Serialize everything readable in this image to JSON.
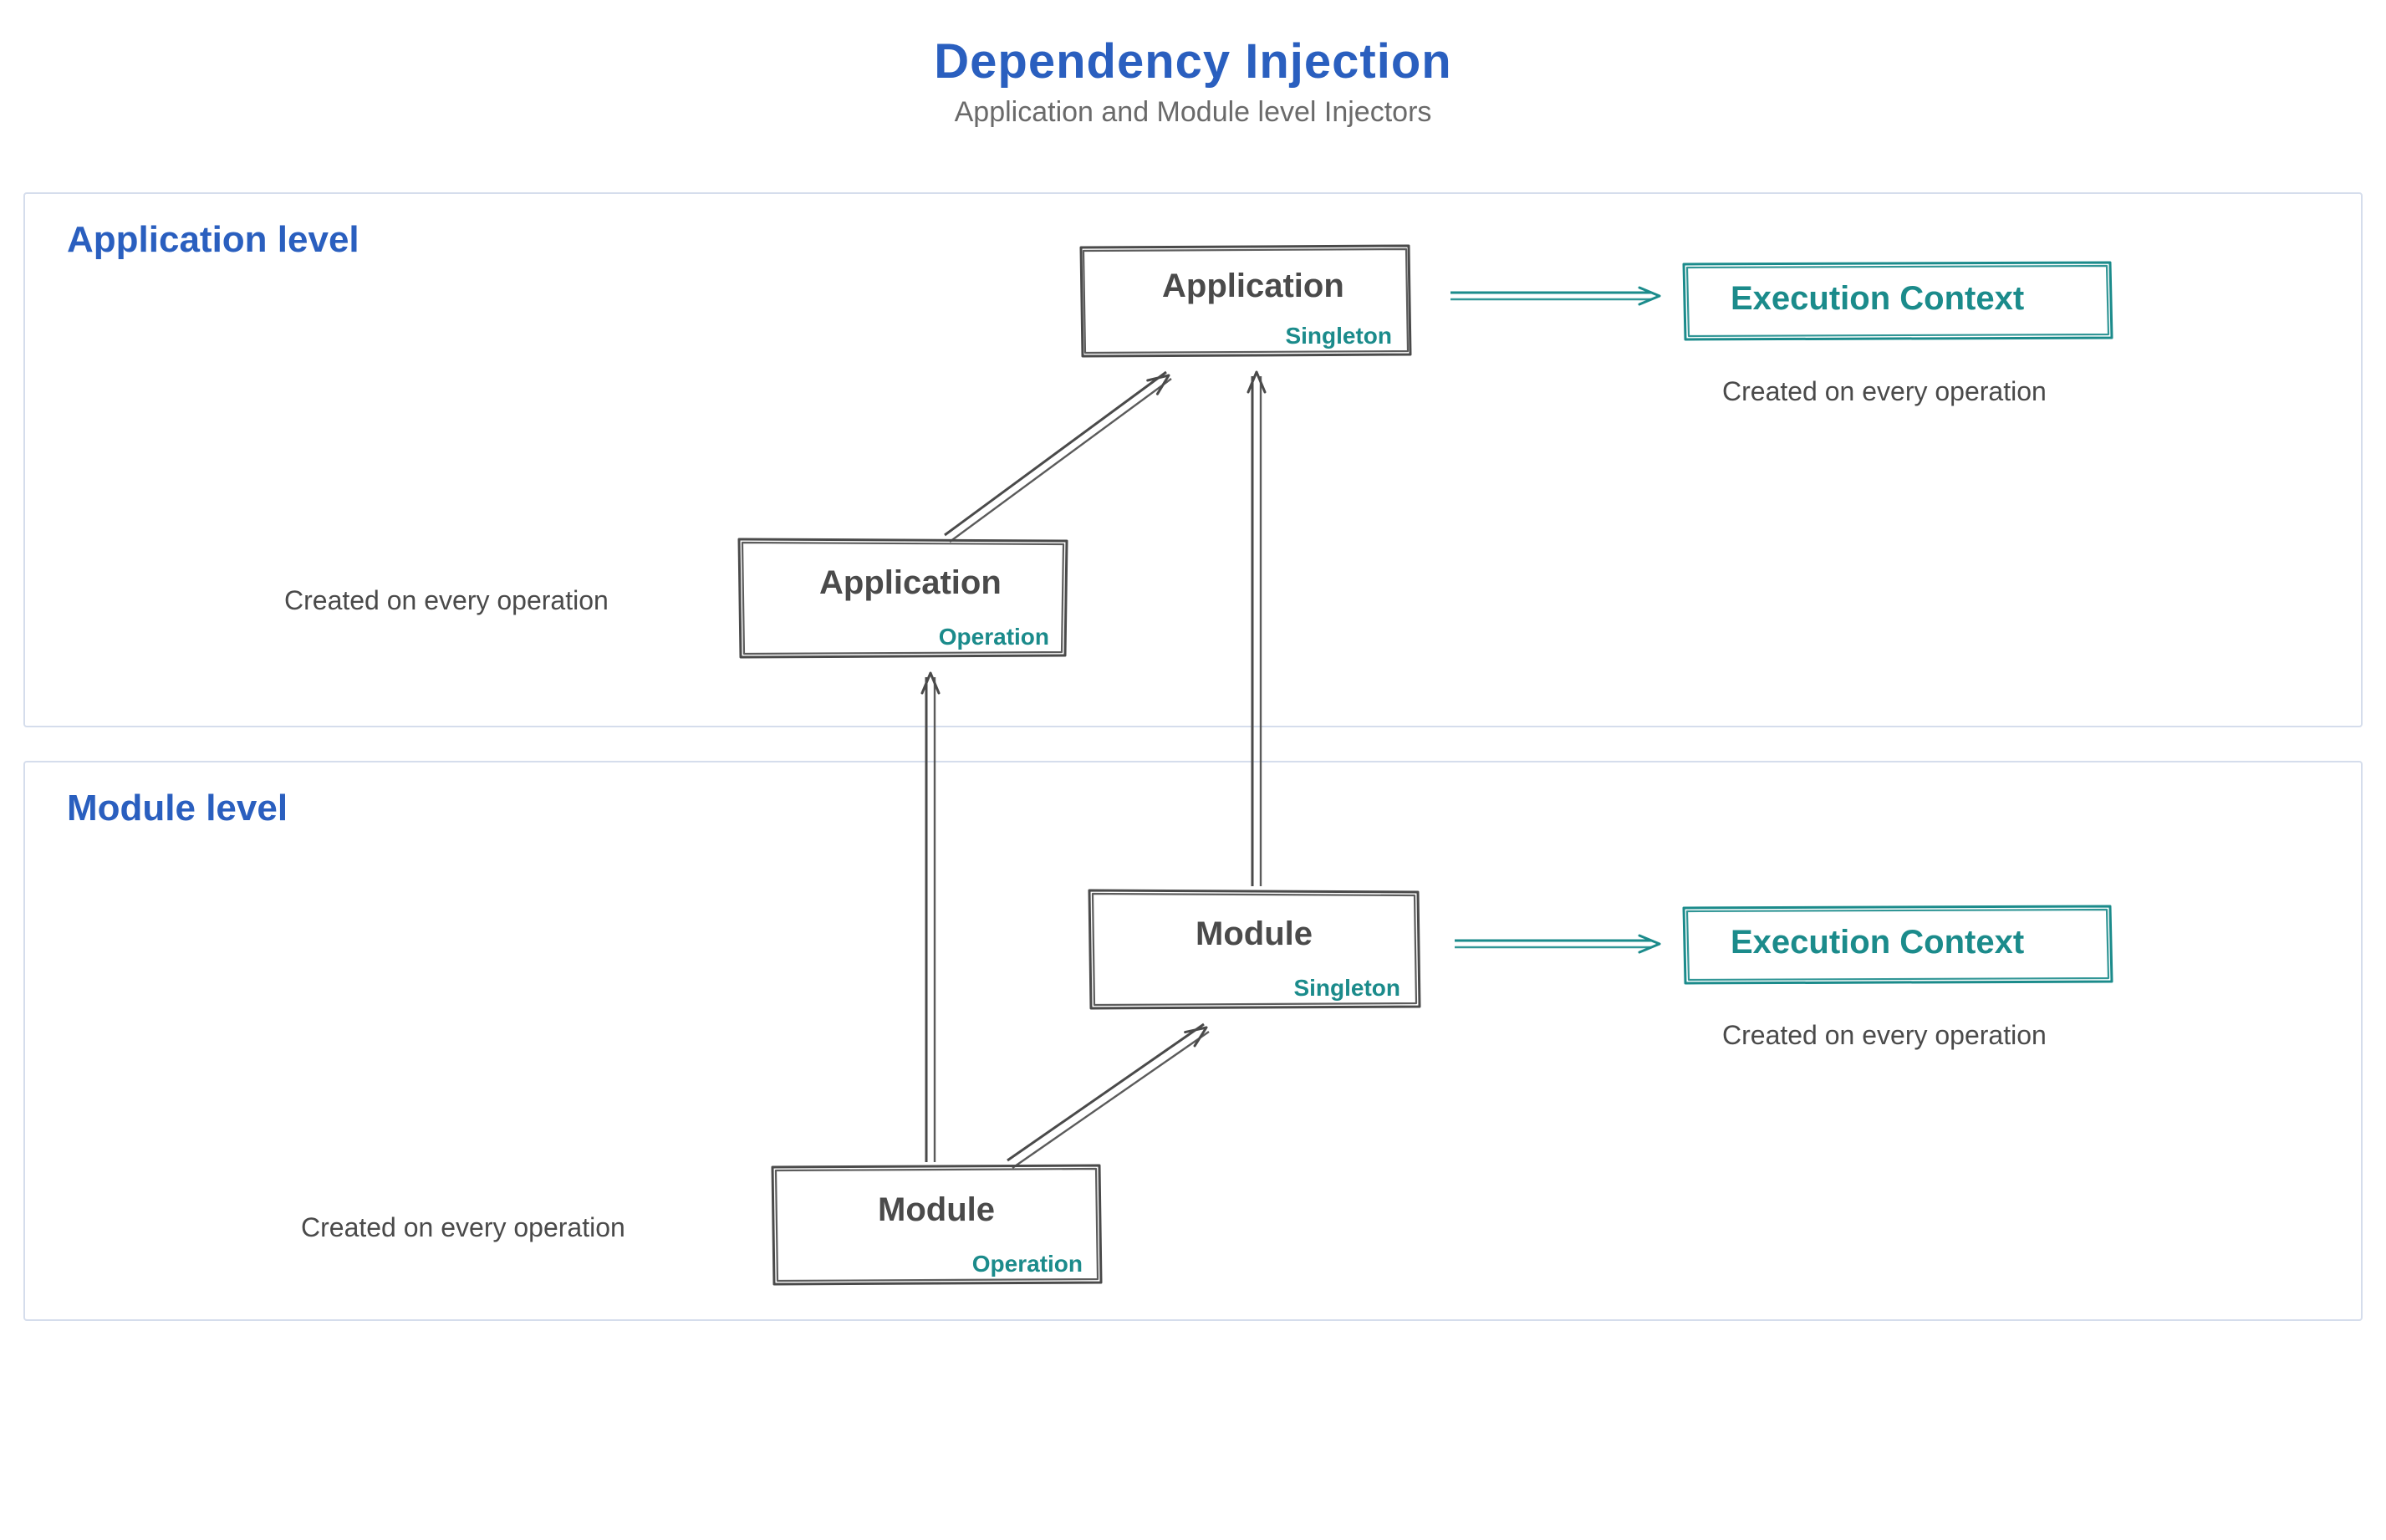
{
  "title": "Dependency Injection",
  "subtitle": "Application and Module level Injectors",
  "sections": {
    "app": {
      "label": "Application level"
    },
    "mod": {
      "label": "Module level"
    }
  },
  "nodes": {
    "appSingleton": {
      "main": "Application",
      "sub": "Singleton"
    },
    "appOperation": {
      "main": "Application",
      "sub": "Operation"
    },
    "appExec": {
      "main": "Execution Context",
      "sub": ""
    },
    "modSingleton": {
      "main": "Module",
      "sub": "Singleton"
    },
    "modOperation": {
      "main": "Module",
      "sub": "Operation"
    },
    "modExec": {
      "main": "Execution Context",
      "sub": ""
    }
  },
  "captions": {
    "appOpCaption": "Created on every operation",
    "appExecCaption": "Created on every operation",
    "modOpCaption": "Created on every operation",
    "modExecCaption": "Created on every operation"
  },
  "colors": {
    "ink": "#4a4a4a",
    "teal": "#1b8b8b",
    "blue": "#2a5fbf",
    "sectionBorder": "#d5ddec"
  }
}
